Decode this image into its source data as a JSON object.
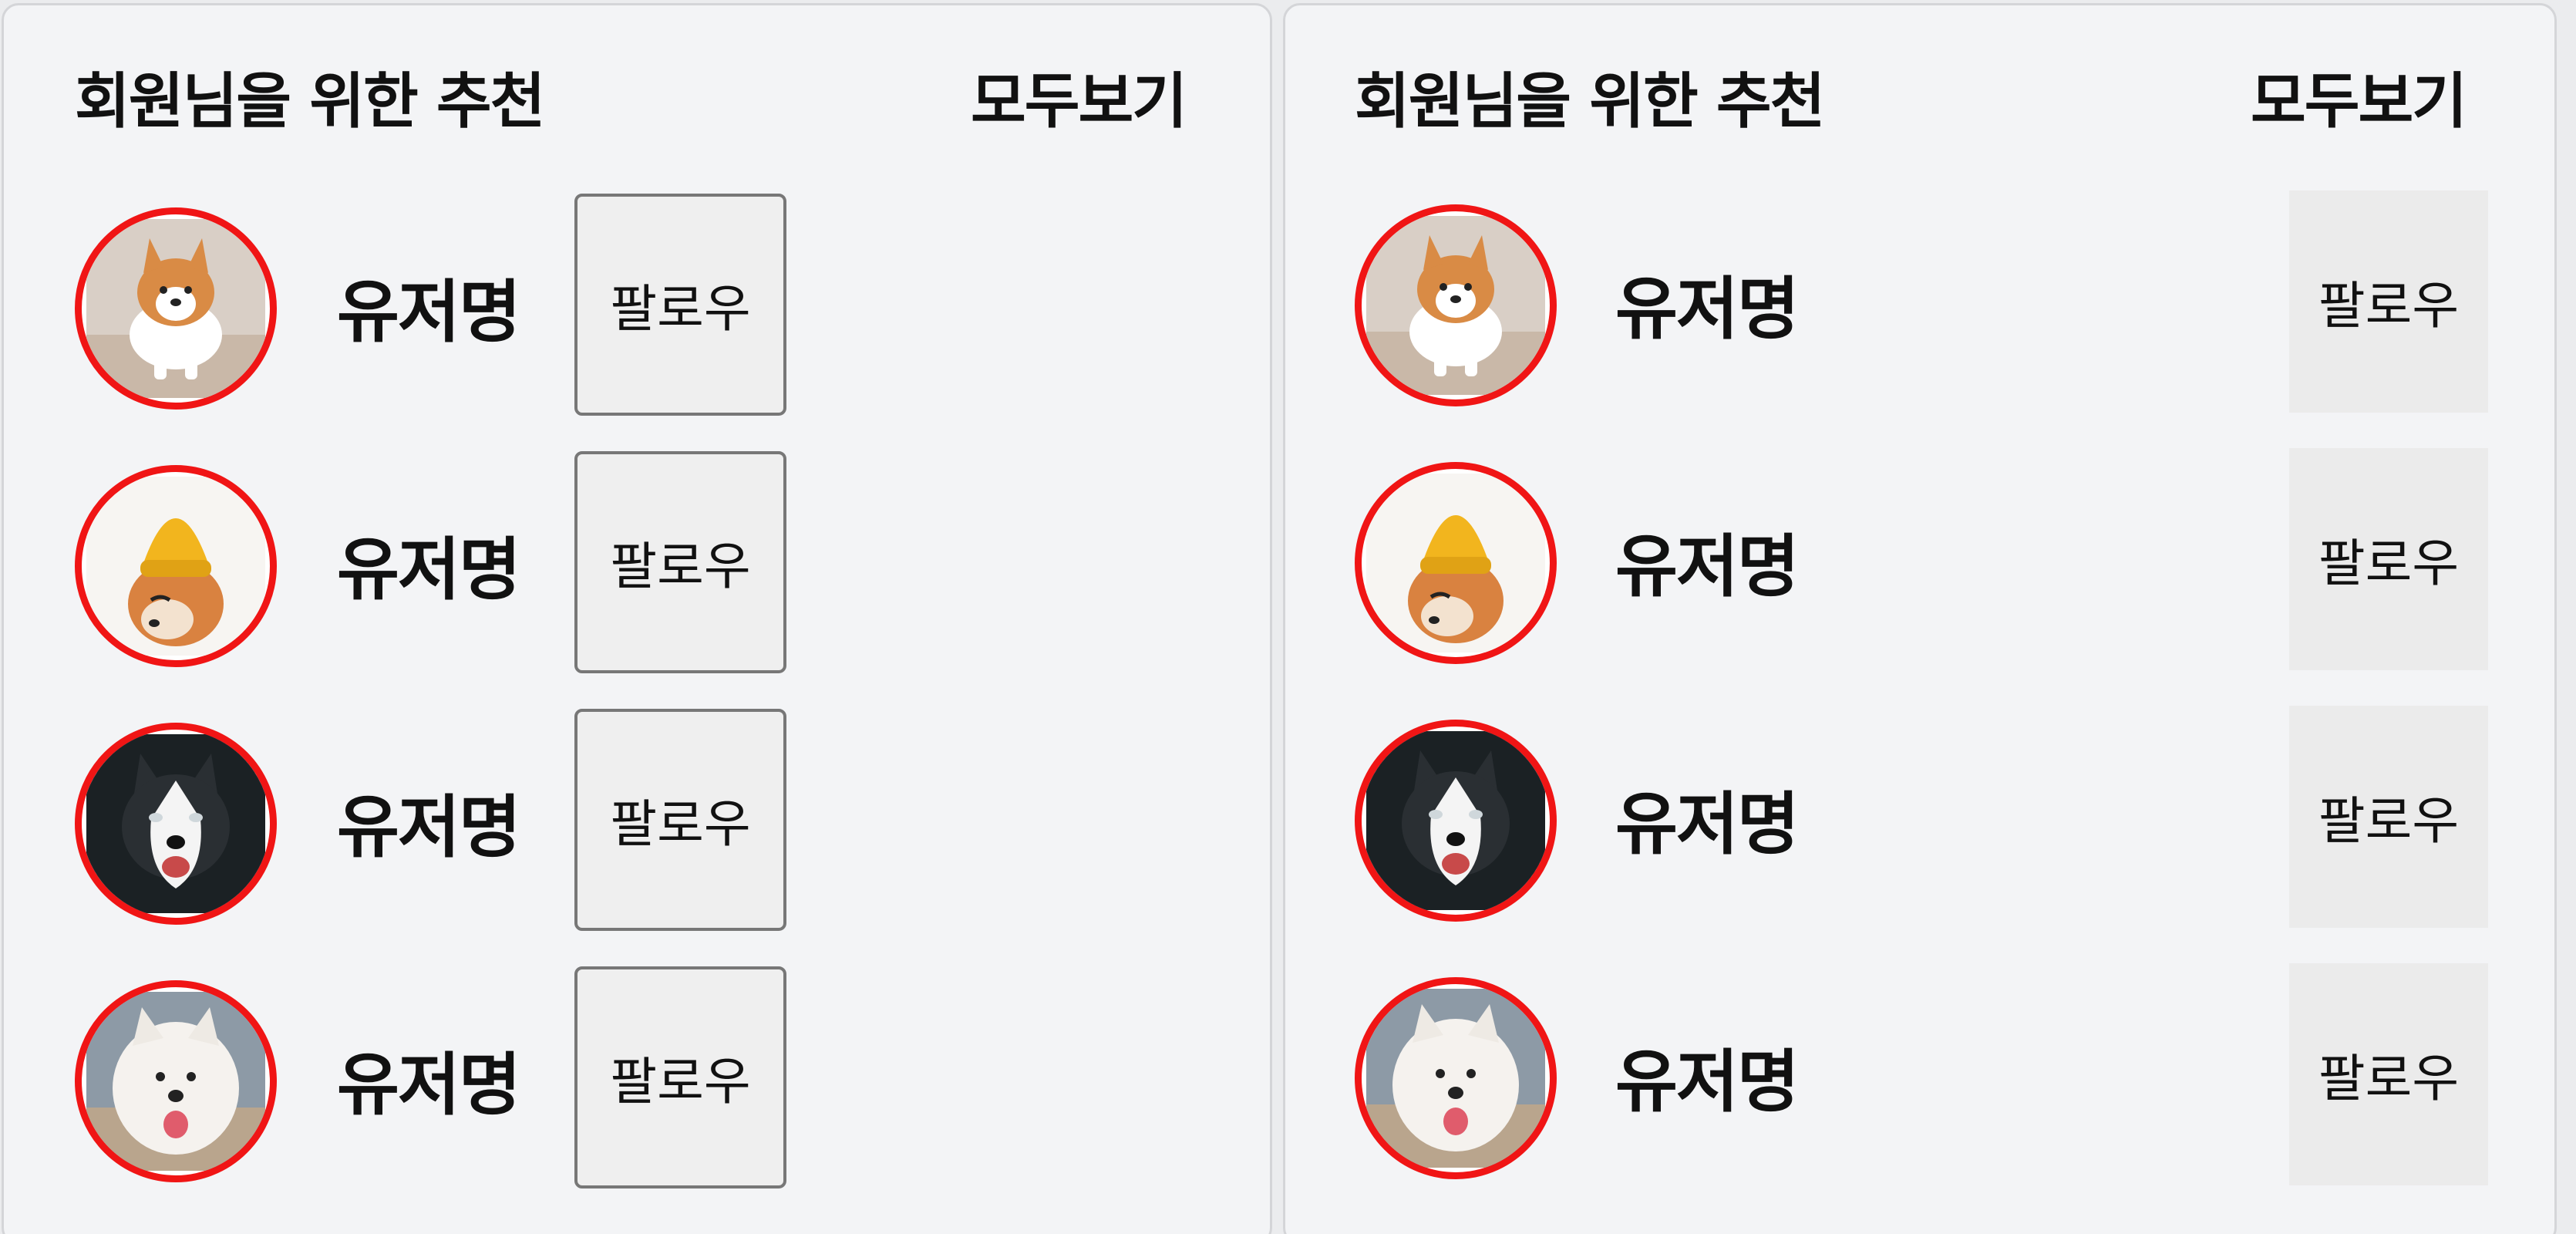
{
  "panels": [
    {
      "title": "회원님을 위한 추천",
      "see_all": "모두보기",
      "users": [
        {
          "name": "유저명",
          "follow": "팔로우",
          "avatar_icon": "corgi-icon"
        },
        {
          "name": "유저명",
          "follow": "팔로우",
          "avatar_icon": "shiba-beanie-icon"
        },
        {
          "name": "유저명",
          "follow": "팔로우",
          "avatar_icon": "husky-icon"
        },
        {
          "name": "유저명",
          "follow": "팔로우",
          "avatar_icon": "samoyed-icon"
        }
      ]
    },
    {
      "title": "회원님을 위한 추천",
      "see_all": "모두보기",
      "users": [
        {
          "name": "유저명",
          "follow": "팔로우",
          "avatar_icon": "corgi-icon"
        },
        {
          "name": "유저명",
          "follow": "팔로우",
          "avatar_icon": "shiba-beanie-icon"
        },
        {
          "name": "유저명",
          "follow": "팔로우",
          "avatar_icon": "husky-icon"
        },
        {
          "name": "유저명",
          "follow": "팔로우",
          "avatar_icon": "samoyed-icon"
        }
      ]
    }
  ],
  "colors": {
    "ring": "#f01515",
    "panel_bg": "#f3f4f6",
    "text": "#111111"
  }
}
